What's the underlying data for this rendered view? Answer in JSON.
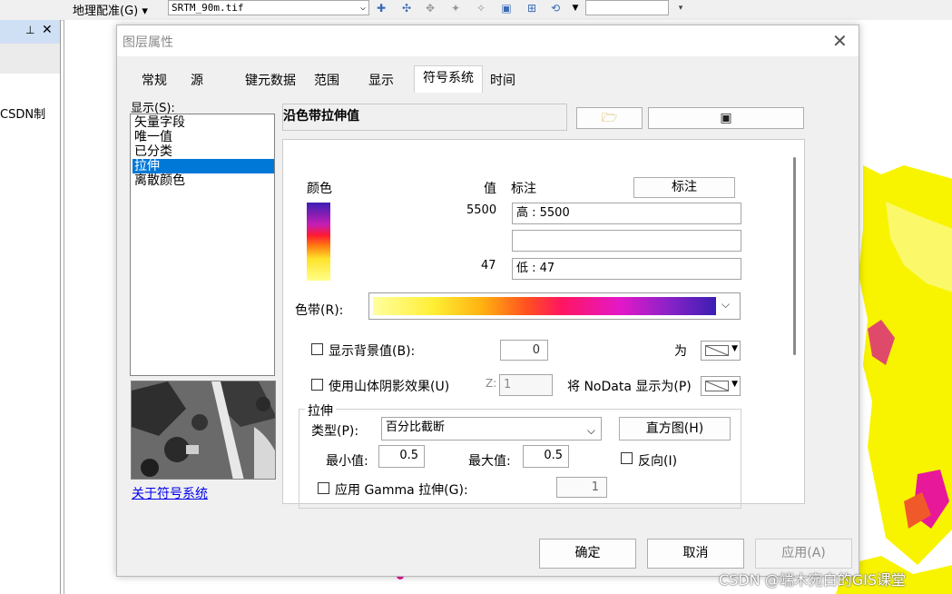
{
  "toolbar": {
    "georef_label": "地理配准(G) ▾",
    "layer_combo": "SRTM_90m.tif",
    "icons": [
      "add-control-point-icon",
      "auto-adjust-icon",
      "rotate-icon",
      "flip-icon",
      "shift-icon",
      "view-link-table-icon",
      "view-table-icon",
      "refresh-icon"
    ]
  },
  "dock": {
    "pin_glyph": "ᵠ",
    "close_glyph": "✕",
    "partial_text": "CSDN制"
  },
  "dialog": {
    "title": "图层属性",
    "tabs": [
      {
        "label": "常规"
      },
      {
        "label": "源"
      },
      {
        "label": "键元数据"
      },
      {
        "label": "范围"
      },
      {
        "label": "显示"
      },
      {
        "label": "符号系统"
      },
      {
        "label": "时间"
      }
    ],
    "active_tab": "符号系统",
    "show": {
      "label": "显示(S):",
      "items": [
        "矢量字段",
        "唯一值",
        "已分类",
        "拉伸",
        "离散颜色"
      ],
      "selected": "拉伸"
    },
    "about_link": "关于符号系统",
    "renderer_title": "沿色带拉伸值",
    "open_icon": "folder-open-icon",
    "save_icon": "save-disk-icon",
    "legend": {
      "color_header": "颜色",
      "value_header": "值",
      "label_header": "标注",
      "label_button": "标注",
      "high_value": "5500",
      "high_label": "高 : 5500",
      "mid_label": "",
      "low_value": "47",
      "low_label": "低 : 47"
    },
    "color_ramp_label": "色带(R):",
    "background": {
      "label": "显示背景值(B):",
      "value": "0",
      "as_label": "为",
      "checked": false
    },
    "hillshade": {
      "label": "使用山体阴影效果(U)",
      "z_label": "Z:",
      "z_value": "1",
      "checked": false
    },
    "nodata_label": "将 NoData 显示为(P)",
    "stretch": {
      "group_title": "拉伸",
      "type_label": "类型(P):",
      "type_value": "百分比截断",
      "histogram_button": "直方图(H)",
      "min_label": "最小值:",
      "min_value": "0.5",
      "max_label": "最大值:",
      "max_value": "0.5",
      "invert_label": "反向(I)",
      "invert_checked": false,
      "gamma_label": "应用 Gamma 拉伸(G):",
      "gamma_value": "1",
      "gamma_checked": false
    },
    "buttons": {
      "ok": "确定",
      "cancel": "取消",
      "apply": "应用(A)"
    }
  },
  "watermark": "CSDN @端木宛白的GIS课堂",
  "colors": {
    "selection": "#0078d7",
    "map_yellow": "#f8f400",
    "map_magenta": "#e8189a"
  }
}
